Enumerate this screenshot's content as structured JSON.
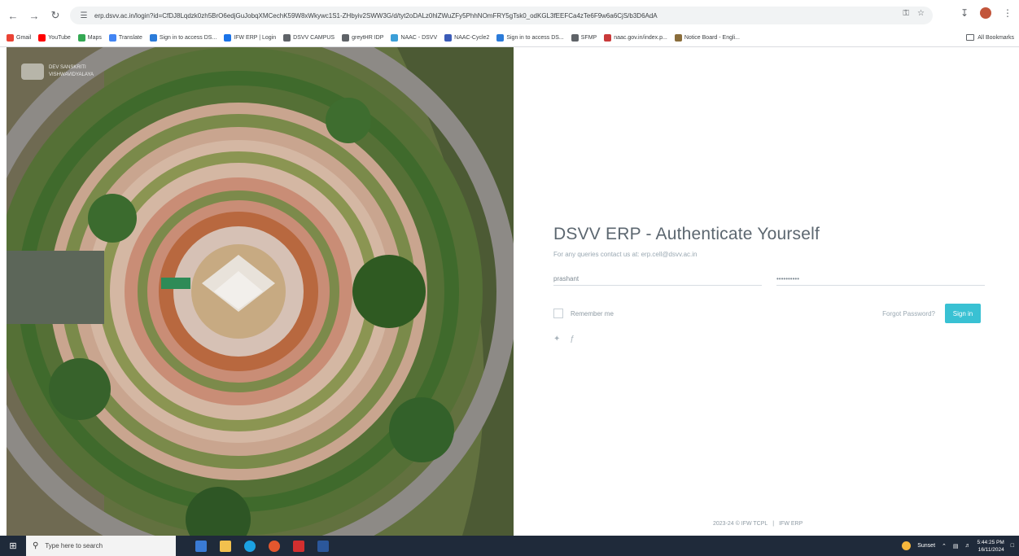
{
  "browser": {
    "url": "erp.dsvv.ac.in/login?id=CfDJ8Lqdzk0zh5BrO6edjGuJobqXMCechK59W8xWkywc1S1-ZHbyiv2SWW3G/d/tyt2oDALz0hlZWuZFy5PhhNOmFRY5gTsk0_odKGL3fEEFCa4zTe6F9w6a6CjS/b3D6AdA",
    "bookmarks": [
      {
        "label": "Gmail",
        "color": "#ea4335"
      },
      {
        "label": "YouTube",
        "color": "#ff0000"
      },
      {
        "label": "Maps",
        "color": "#34a853"
      },
      {
        "label": "Translate",
        "color": "#4285f4"
      },
      {
        "label": "Sign in to access DS...",
        "color": "#2b7bd9"
      },
      {
        "label": "IFW ERP | Login",
        "color": "#1a73e8"
      },
      {
        "label": "DSVV CAMPUS",
        "color": "#5f6368"
      },
      {
        "label": "greytHR IDP",
        "color": "#5f6368"
      },
      {
        "label": "NAAC - DSVV",
        "color": "#3c9fd8"
      },
      {
        "label": "NAAC-Cycle2",
        "color": "#3b5bb8"
      },
      {
        "label": "Sign in to access DS...",
        "color": "#2b7bd9"
      },
      {
        "label": "SFMP",
        "color": "#5f6368"
      },
      {
        "label": "naac.gov.in/index.p...",
        "color": "#c93a3a"
      },
      {
        "label": "Notice Board - Engli...",
        "color": "#8a6d3b"
      }
    ],
    "all_bookmarks": "All Bookmarks"
  },
  "hero": {
    "logo_line1": "DEV SANSKRITI",
    "logo_line2": "VISHWAVIDYALAYA"
  },
  "login": {
    "title": "DSVV ERP - Authenticate Yourself",
    "subtitle": "For any queries contact us at: erp.cell@dsvv.ac.in",
    "username_value": "prashant",
    "password_value": "••••••••••",
    "remember_label": "Remember me",
    "forgot_label": "Forgot Password?",
    "signin_label": "Sign in"
  },
  "footer": {
    "copyright": "2023-24 © IFW TCPL",
    "separator": "|",
    "product": "IFW ERP"
  },
  "taskbar": {
    "search_placeholder": "Type here to search",
    "weather": "Sunset",
    "time": "5:44:25 PM",
    "date": "16/11/2024"
  }
}
